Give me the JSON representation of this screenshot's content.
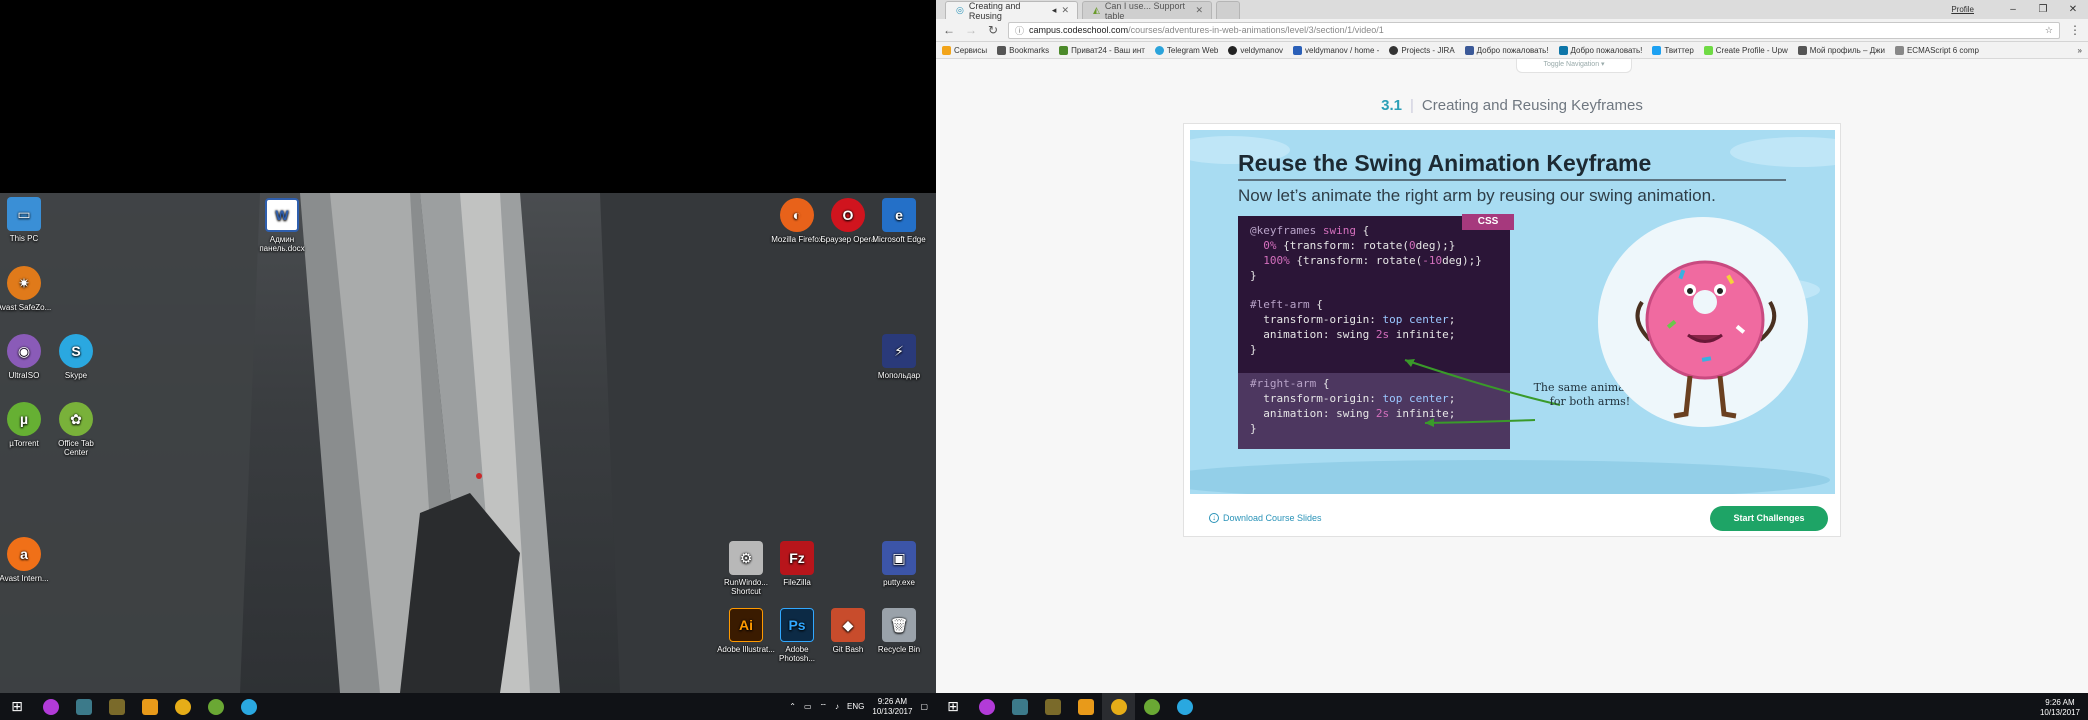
{
  "left_desktop": {
    "icons_left": [
      {
        "label": "This PC",
        "color": "#3a8fd6",
        "glyph": "▭",
        "icon": "computer-icon"
      },
      {
        "label": "Avast SafeZo...",
        "color": "#e07a1a",
        "glyph": "✷",
        "icon": "avast-safezone-icon"
      },
      {
        "label": "UltraISO",
        "color": "#8a5bb8",
        "glyph": "◉",
        "icon": "ultraiso-icon"
      },
      {
        "label": "Skype",
        "color": "#2aa8e0",
        "glyph": "S",
        "icon": "skype-icon"
      },
      {
        "label": "µTorrent",
        "color": "#66b033",
        "glyph": "µ",
        "icon": "utorrent-icon"
      },
      {
        "label": "Office Tab Center",
        "color": "#79b13a",
        "glyph": "✿",
        "icon": "office-tab-icon"
      },
      {
        "label": "Avast Intern...",
        "color": "#f07018",
        "glyph": "a",
        "icon": "avast-icon"
      }
    ],
    "word_doc": {
      "label": "Админ панель.docx",
      "color": "#2f5fae",
      "glyph": "W"
    },
    "icons_right": [
      {
        "label": "Mozilla Firefox",
        "color": "#e8621a",
        "glyph": "◐",
        "icon": "firefox-icon"
      },
      {
        "label": "Браузер Opera",
        "color": "#d0141e",
        "glyph": "O",
        "icon": "opera-icon"
      },
      {
        "label": "Microsoft Edge",
        "color": "#2470c8",
        "glyph": "e",
        "icon": "edge-icon"
      },
      {
        "label": "Мопольдар",
        "color": "#2a3a7a",
        "glyph": "⚡",
        "icon": "monolar-icon"
      },
      {
        "label": "RunWindo... Shortcut",
        "color": "#b8b8b8",
        "glyph": "⚙",
        "icon": "shortcut-icon"
      },
      {
        "label": "FileZilla",
        "color": "#b8151b",
        "glyph": "Fz",
        "icon": "filezilla-icon"
      },
      {
        "label": "putty.exe",
        "color": "#3c55a8",
        "glyph": "▣",
        "icon": "putty-icon"
      },
      {
        "label": "Adobe Illustrat...",
        "color": "#3a1b00",
        "glyph": "Ai",
        "icon": "illustrator-icon"
      },
      {
        "label": "Adobe Photosh...",
        "color": "#0c2a45",
        "glyph": "Ps",
        "icon": "photoshop-icon"
      },
      {
        "label": "Git Bash",
        "color": "#c84c2c",
        "glyph": "◆",
        "icon": "git-icon"
      },
      {
        "label": "Recycle Bin",
        "color": "#9aa2aa",
        "glyph": "🗑",
        "icon": "recycle-bin-icon"
      }
    ],
    "tray": {
      "lang": "ENG",
      "time": "9:26 AM",
      "date": "10/13/2017"
    }
  },
  "taskbar_apps": [
    "#b23bd8",
    "#3c7a8a",
    "#7a6a2a",
    "#e89a1a",
    "#e6ad18",
    "#6aa834",
    "#2aa8e0"
  ],
  "browser": {
    "tabs": [
      {
        "title": "Creating and Reusing",
        "active": true
      },
      {
        "title": "Can I use... Support table",
        "active": false
      }
    ],
    "user": "Profile",
    "url_host": "campus.codeschool.com",
    "url_path": "/courses/adventures-in-web-animations/level/3/section/1/video/1",
    "bookmarks": [
      {
        "label": "Сервисы",
        "color": "#f2a419"
      },
      {
        "label": "Bookmarks",
        "color": "#555555"
      },
      {
        "label": "Приват24 - Ваш инт",
        "color": "#4c8a2a"
      },
      {
        "label": "Telegram Web",
        "color": "#2aa3db"
      },
      {
        "label": "veldymanov",
        "color": "#222222"
      },
      {
        "label": "veldymanov / home -",
        "color": "#2a5fb8"
      },
      {
        "label": "Projects - JIRA",
        "color": "#333333"
      },
      {
        "label": "Добро пожаловать!",
        "color": "#3b5998"
      },
      {
        "label": "Добро пожаловать!",
        "color": "#0e76a8"
      },
      {
        "label": "Твиттер",
        "color": "#1da1f2"
      },
      {
        "label": "Create Profile - Upw",
        "color": "#6fda44"
      },
      {
        "label": "Мой профиль – Джи",
        "color": "#555555"
      },
      {
        "label": "ECMAScript 6 comp",
        "color": "#888888"
      }
    ]
  },
  "page": {
    "toggle_nav": "Toggle Navigation ▾",
    "lesson_number": "3.1",
    "lesson_title": "Creating and Reusing Keyframes",
    "slide": {
      "title": "Reuse the Swing Animation Keyframe",
      "subtitle": "Now let’s animate the right arm by reusing our swing animation.",
      "code_tag": "CSS",
      "annotation": "The same animation for both arms!"
    },
    "download_label": "Download Course Slides",
    "start_button": "Start Challenges"
  }
}
